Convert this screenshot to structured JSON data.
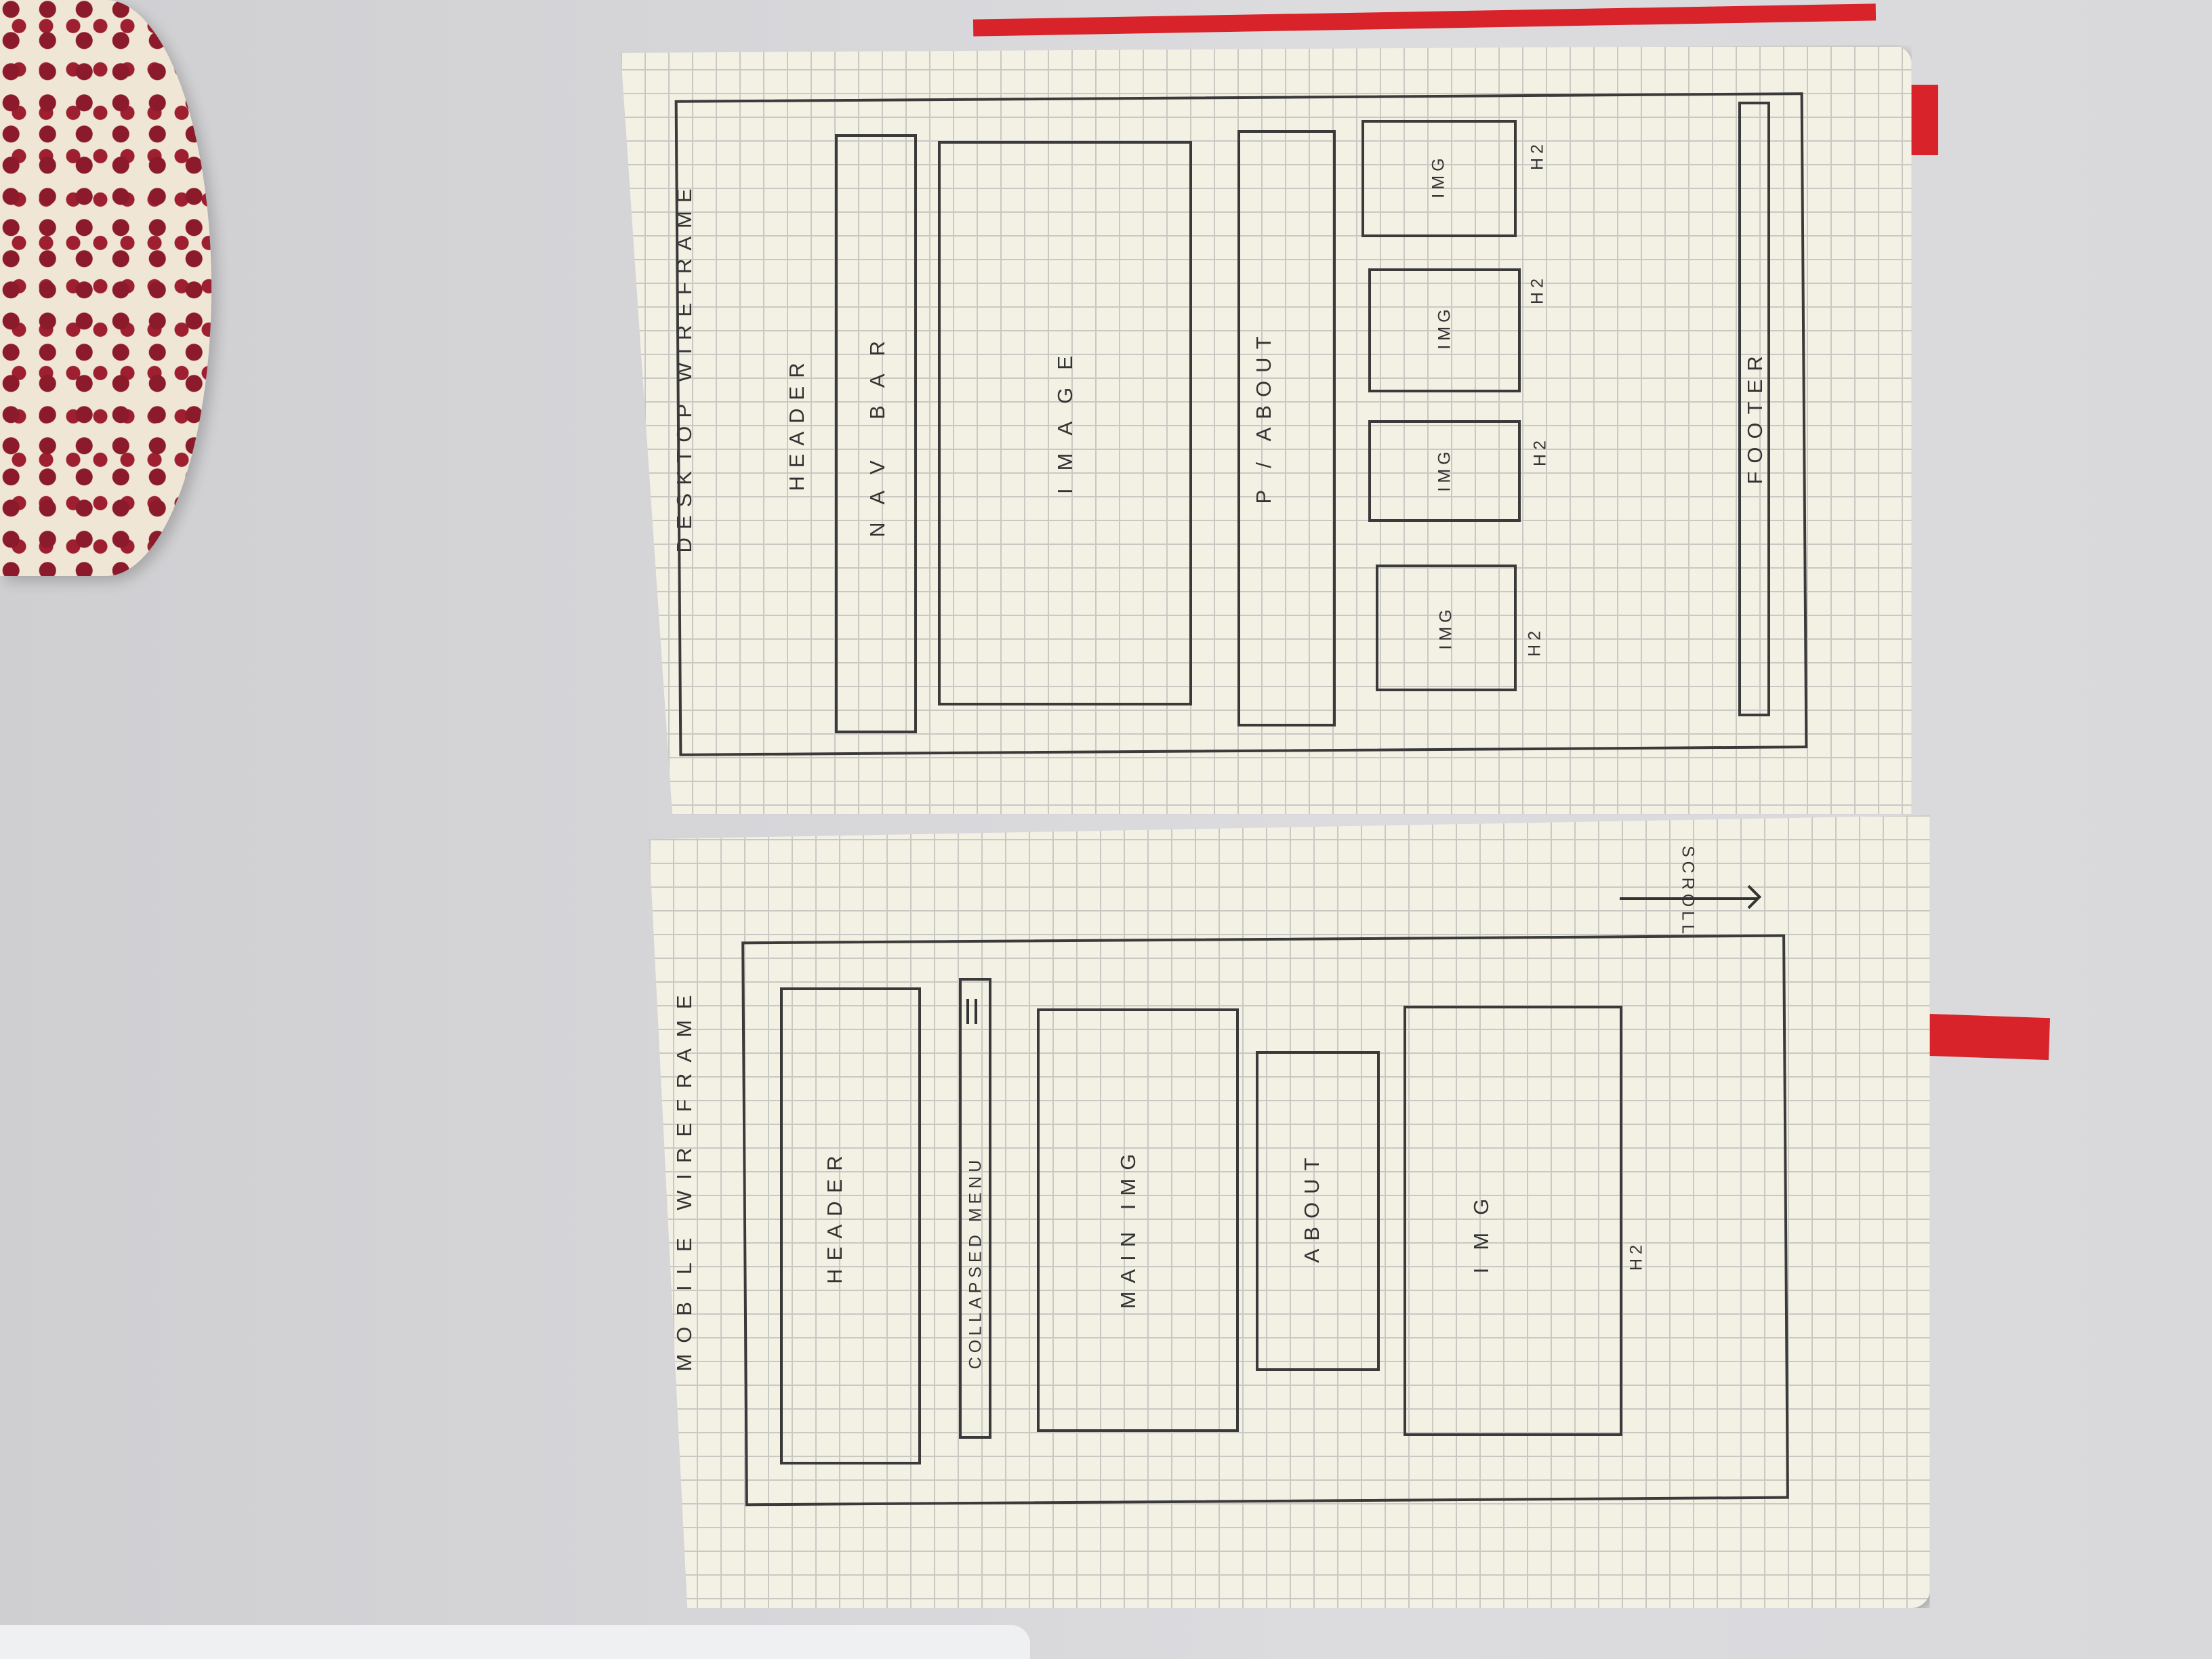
{
  "desktop": {
    "title": "DESKTOP WIREFRAME",
    "header": "HEADER",
    "nav": "NAV BAR",
    "image": "IMAGE",
    "about": "P / ABOUT",
    "img_labels": [
      "IMG",
      "IMG",
      "IMG",
      "IMG"
    ],
    "h2_labels": [
      "H2",
      "H2",
      "H2",
      "H2"
    ],
    "footer": "FOOTER"
  },
  "mobile": {
    "title": "MOBILE WIREFRAME",
    "header": "HEADER",
    "menu": "COLLAPSED MENU",
    "main_img": "MAIN IMG",
    "about": "ABOUT",
    "img": "IMG",
    "h2": "H2",
    "scroll": "SCROLL"
  },
  "colors": {
    "ink": "#3a3a3a",
    "paper": "#f3f0e4",
    "ribbon": "#d8232a"
  }
}
